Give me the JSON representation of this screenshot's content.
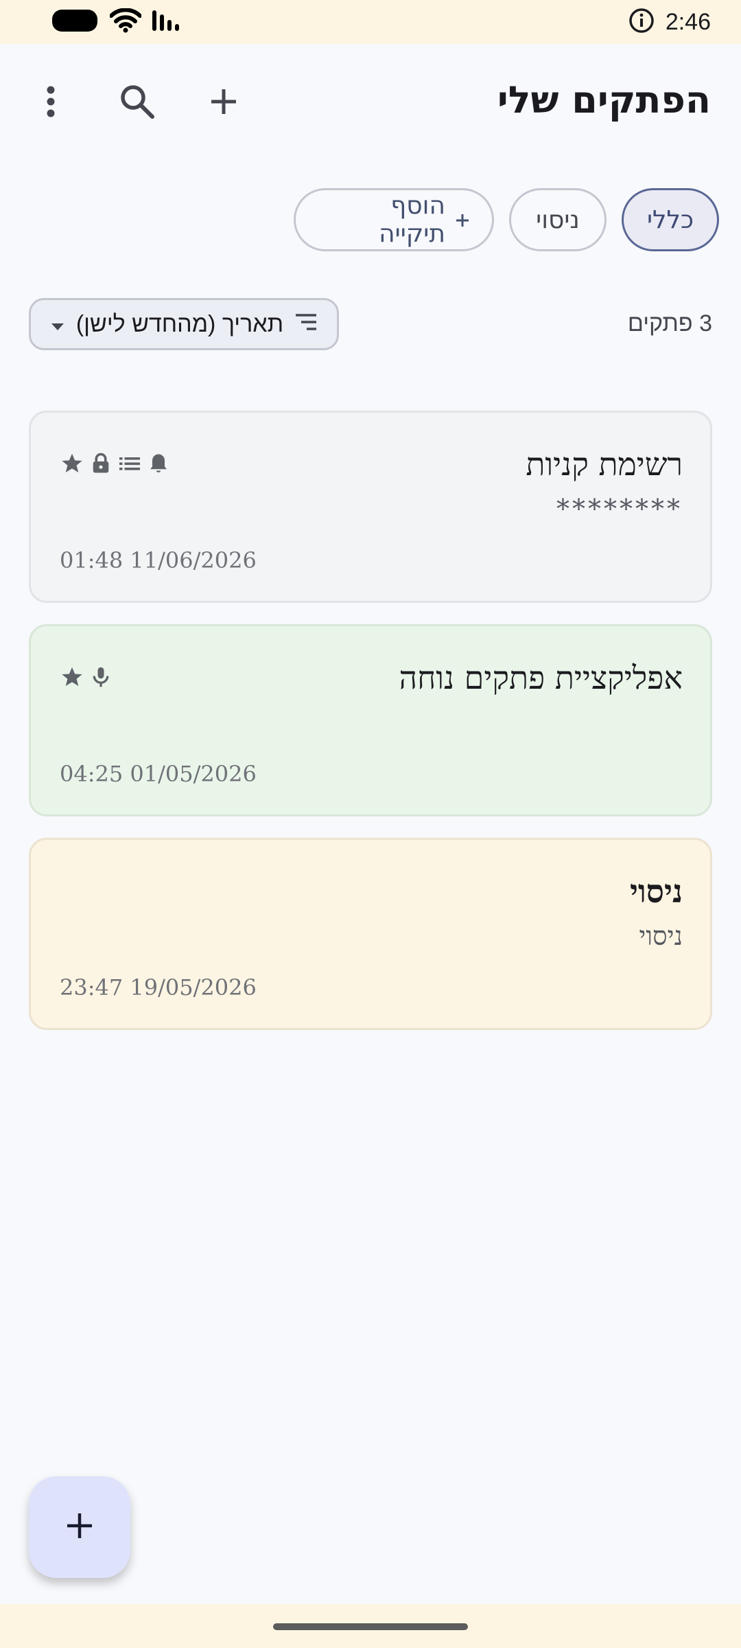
{
  "status_bar": {
    "time": "2:46",
    "icons": [
      "battery-icon",
      "wifi-icon",
      "signal-icon",
      "info-icon"
    ]
  },
  "app_bar": {
    "title": "הפתקים שלי",
    "icons": [
      "more-vert-icon",
      "search-icon",
      "add-icon"
    ]
  },
  "folders": [
    {
      "label": "כללי",
      "selected": true
    },
    {
      "label": "ניסוי",
      "selected": false
    }
  ],
  "add_folder_label": "הוסף תיקייה",
  "notes_count": "3 פתקים",
  "sort_label": "תאריך (מהחדש לישן)",
  "notes": [
    {
      "title": "רשימת קניות",
      "body": "********",
      "date": "01:48 11/06/2026",
      "background": "#f3f4f6",
      "border": "#e1e3e7",
      "icons": [
        "star-icon",
        "lock-icon",
        "list-icon",
        "bell-icon"
      ]
    },
    {
      "title": "אפליקציית פתקים נוחה",
      "body": "",
      "date": "04:25 01/05/2026",
      "background": "#eaf5ea",
      "border": "#d8e7d8",
      "icons": [
        "star-icon",
        "mic-icon"
      ]
    },
    {
      "title": "ניסוי",
      "body": "ניסוי",
      "date": "23:47 19/05/2026",
      "background": "#fdf5e3",
      "border": "#ece3cf",
      "icons": []
    }
  ],
  "colors": {
    "accent": "#3e4a73",
    "fab_bg": "#dfe2fb",
    "icon": "#5f6368"
  }
}
